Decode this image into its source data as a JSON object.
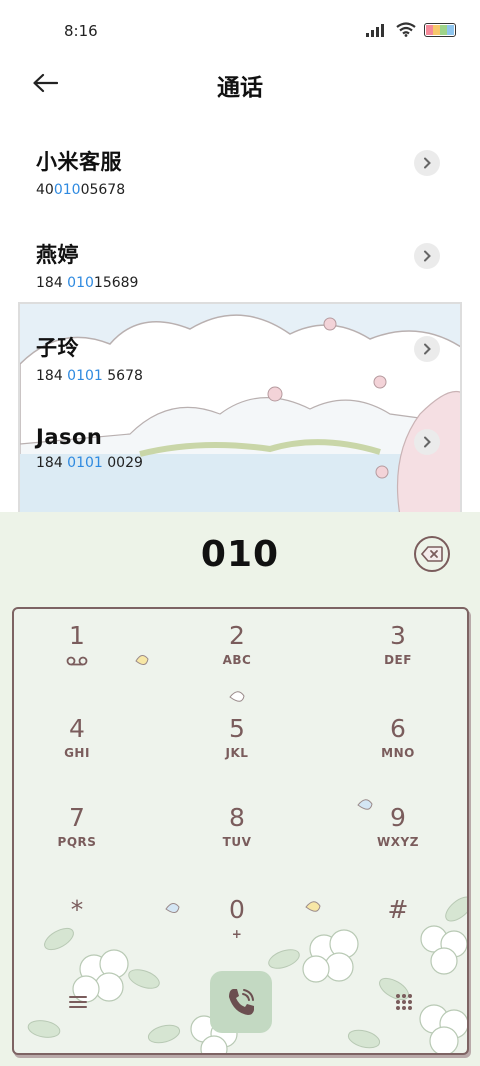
{
  "status_bar": {
    "time": "8:16"
  },
  "header": {
    "title": "通话"
  },
  "contacts": [
    {
      "name": "小米客服",
      "number_pre": "40",
      "number_match": "010",
      "number_post": "05678"
    },
    {
      "name": "燕婷",
      "number_pre": "184 ",
      "number_match": "010",
      "number_post": "15689"
    },
    {
      "name": "子玲",
      "number_pre": "184 ",
      "number_match": "0101",
      "number_post": " 5678"
    },
    {
      "name": "Jason",
      "number_pre": "184 ",
      "number_match": "0101",
      "number_post": " 0029"
    }
  ],
  "dialer": {
    "number": "010",
    "keys": [
      {
        "digit": "1",
        "letters": ""
      },
      {
        "digit": "2",
        "letters": "ABC"
      },
      {
        "digit": "3",
        "letters": "DEF"
      },
      {
        "digit": "4",
        "letters": "GHI"
      },
      {
        "digit": "5",
        "letters": "JKL"
      },
      {
        "digit": "6",
        "letters": "MNO"
      },
      {
        "digit": "7",
        "letters": "PQRS"
      },
      {
        "digit": "8",
        "letters": "TUV"
      },
      {
        "digit": "9",
        "letters": "WXYZ"
      },
      {
        "digit": "*",
        "letters": ""
      },
      {
        "digit": "0",
        "letters": "+"
      },
      {
        "digit": "#",
        "letters": ""
      }
    ]
  },
  "colors": {
    "highlight": "#2f8ae0",
    "keypad_ink": "#7a5c5c",
    "dialer_bg": "#edf3e8",
    "call_button": "#c3d9c2"
  },
  "icons": [
    "back-arrow-icon",
    "chevron-right-icon",
    "backspace-icon",
    "voicemail-icon",
    "phone-icon",
    "menu-icon",
    "dialpad-icon",
    "signal-icon",
    "wifi-icon",
    "battery-icon"
  ]
}
